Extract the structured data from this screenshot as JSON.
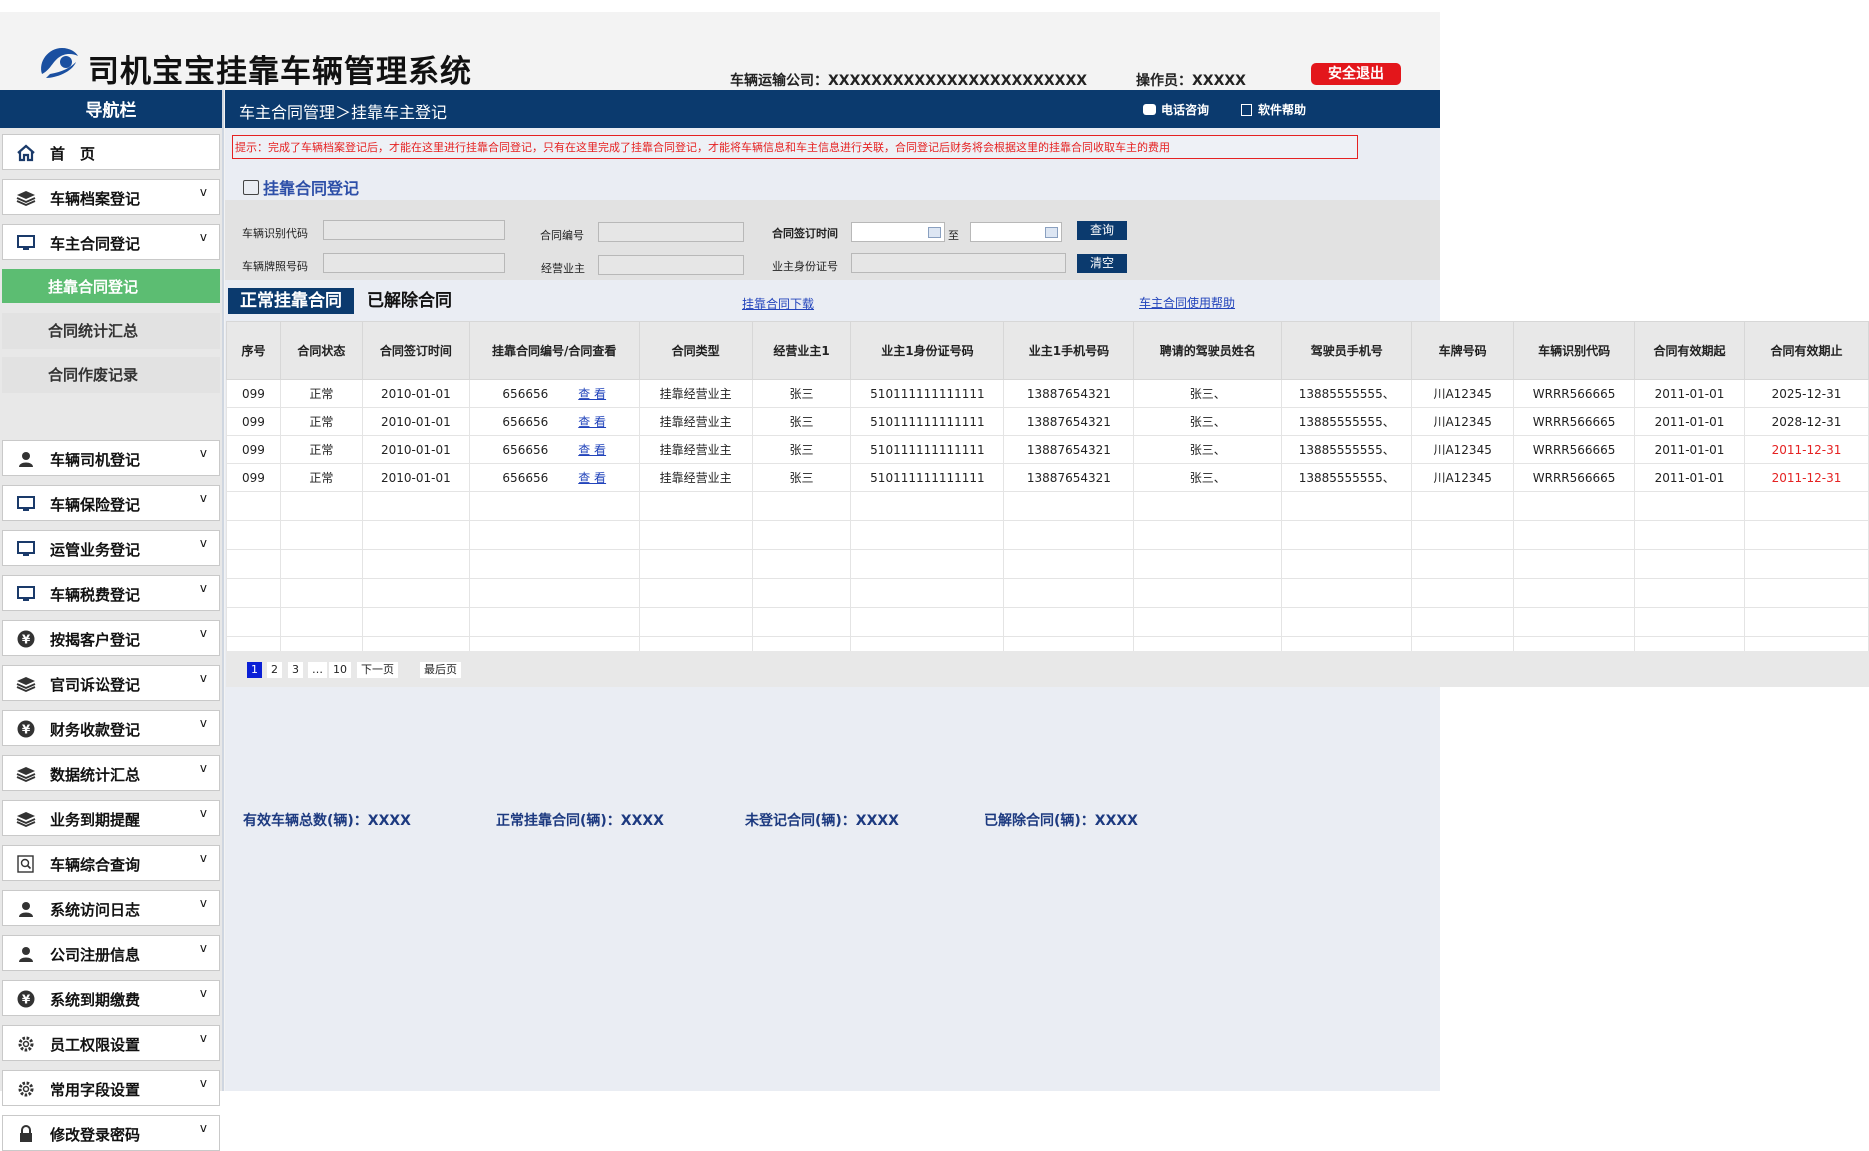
{
  "header": {
    "title": "司机宝宝挂靠车辆管理系统",
    "company": "车辆运输公司：XXXXXXXXXXXXXXXXXXXXXXXX",
    "operator": "操作员：XXXXX",
    "logout": "安全退出"
  },
  "sidebar": {
    "title": "导航栏",
    "items": [
      {
        "label": "首　页",
        "icon": "home-icon",
        "chev": ""
      },
      {
        "label": "车辆档案登记",
        "icon": "stack-icon",
        "chev": "v"
      },
      {
        "label": "车主合同登记",
        "icon": "monitor-icon",
        "chev": "v"
      },
      {
        "label": "车辆司机登记",
        "icon": "user-icon",
        "chev": "v"
      },
      {
        "label": "车辆保险登记",
        "icon": "monitor-icon",
        "chev": "v"
      },
      {
        "label": "运管业务登记",
        "icon": "monitor-icon",
        "chev": "v"
      },
      {
        "label": "车辆税费登记",
        "icon": "monitor-icon",
        "chev": "v"
      },
      {
        "label": "按揭客户登记",
        "icon": "yen-icon",
        "chev": "v"
      },
      {
        "label": "官司诉讼登记",
        "icon": "stack-icon",
        "chev": "v"
      },
      {
        "label": "财务收款登记",
        "icon": "yen-icon",
        "chev": "v"
      },
      {
        "label": "数据统计汇总",
        "icon": "stack-icon",
        "chev": "v"
      },
      {
        "label": "业务到期提醒",
        "icon": "stack-icon",
        "chev": "v"
      },
      {
        "label": "车辆综合查询",
        "icon": "search-icon",
        "chev": "v"
      },
      {
        "label": "系统访问日志",
        "icon": "user-icon",
        "chev": "v"
      },
      {
        "label": "公司注册信息",
        "icon": "user-icon",
        "chev": "v"
      },
      {
        "label": "系统到期缴费",
        "icon": "yen-icon",
        "chev": "v"
      },
      {
        "label": "员工权限设置",
        "icon": "gear-icon",
        "chev": "v"
      },
      {
        "label": "常用字段设置",
        "icon": "gear-icon",
        "chev": "v"
      },
      {
        "label": "修改登录密码",
        "icon": "lock-icon",
        "chev": "v"
      }
    ],
    "subitems": [
      "挂靠合同登记",
      "合同统计汇总",
      "合同作废记录"
    ]
  },
  "main": {
    "breadcrumb": "车主合同管理＞挂靠车主登记",
    "phone": "电话咨询",
    "help": "软件帮助",
    "notice": "提示：完成了车辆档案登记后，才能在这里进行挂靠合同登记，只有在这里完成了挂靠合同登记，才能将车辆信息和车主信息进行关联，合同登记后财务将会根据这里的挂靠合同收取车主的费用",
    "section_title": "挂靠合同登记",
    "filter": {
      "vin_label": "车辆识别代码",
      "contract_no_label": "合同编号",
      "sign_date_label": "合同签订时间",
      "to": "至",
      "search": "查询",
      "plate_label": "车辆牌照号码",
      "owner_label": "经营业主",
      "id_label": "业主身份证号",
      "clear": "清空"
    },
    "tab_normal": "正常挂靠合同",
    "tab_dissolved": "已解除合同",
    "download_link": "挂靠合同下载",
    "help_link": "车主合同使用帮助",
    "stats": [
      "有效车辆总数(辆)：XXXX",
      "正常挂靠合同(辆)：XXXX",
      "未登记合同(辆)：XXXX",
      "已解除合同(辆)：XXXX"
    ]
  },
  "table": {
    "headers": [
      "序号",
      "合同状态",
      "合同签订时间",
      "挂靠合同编号/合同查看",
      "合同类型",
      "经营业主1",
      "业主1身份证号码",
      "业主1手机号码",
      "聘请的驾驶员姓名",
      "驾驶员手机号",
      "车牌号码",
      "车辆识别代码",
      "合同有效期起",
      "合同有效期止"
    ],
    "view_label": "查 看",
    "rows": [
      [
        "099",
        "正常",
        "2010-01-01",
        "656656",
        "挂靠经营业主",
        "张三",
        "510111111111111",
        "13887654321",
        "张三、",
        "13885555555、",
        "川A12345",
        "WRRR566665",
        "2011-01-01",
        "2025-12-31"
      ],
      [
        "099",
        "正常",
        "2010-01-01",
        "656656",
        "挂靠经营业主",
        "张三",
        "510111111111111",
        "13887654321",
        "张三、",
        "13885555555、",
        "川A12345",
        "WRRR566665",
        "2011-01-01",
        "2028-12-31"
      ],
      [
        "099",
        "正常",
        "2010-01-01",
        "656656",
        "挂靠经营业主",
        "张三",
        "510111111111111",
        "13887654321",
        "张三、",
        "13885555555、",
        "川A12345",
        "WRRR566665",
        "2011-01-01",
        "2011-12-31"
      ],
      [
        "099",
        "正常",
        "2010-01-01",
        "656656",
        "挂靠经营业主",
        "张三",
        "510111111111111",
        "13887654321",
        "张三、",
        "13885555555、",
        "川A12345",
        "WRRR566665",
        "2011-01-01",
        "2011-12-31"
      ]
    ],
    "expired_color": "#e52222"
  },
  "pager": {
    "pages": [
      "1",
      "2",
      "3",
      "…",
      "10"
    ],
    "next": "下一页",
    "last": "最后页",
    "current": "1"
  },
  "colors": {
    "navy": "#0b3a6e",
    "accent_green": "#5cbd72",
    "logout_red": "#e3161b"
  }
}
